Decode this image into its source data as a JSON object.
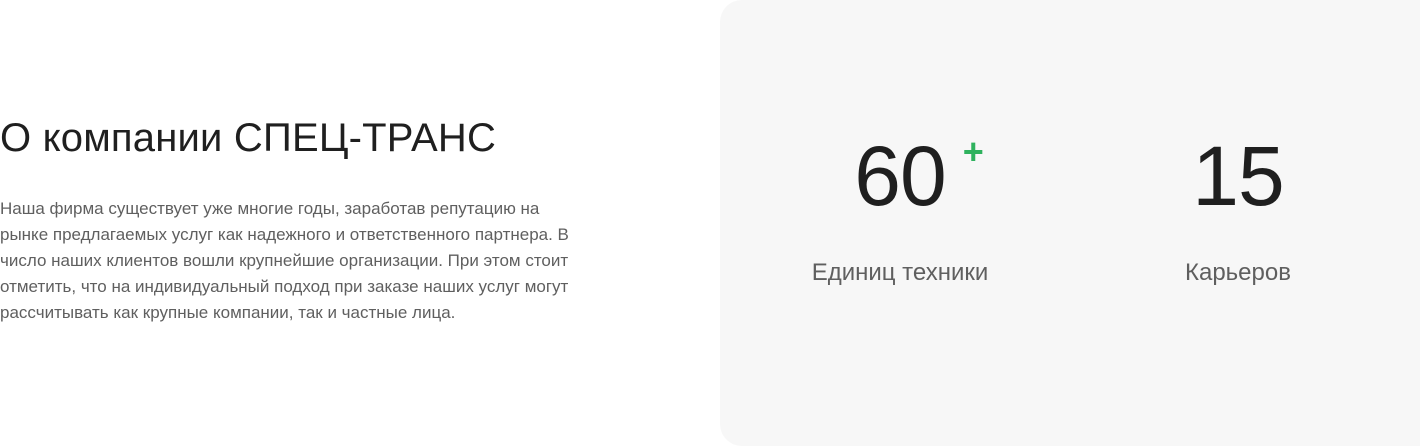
{
  "about": {
    "title": "О компании СПЕЦ-ТРАНС",
    "text": "Наша фирма существует уже многие годы, заработав репутацию на рынке предлагаемых услуг как надежного и ответственного партнера. В число наших клиентов вошли крупнейшие организации. При этом стоит отметить, что на индивидуальный подход при заказе наших услуг могут рассчитывать как крупные компании, так и частные лица."
  },
  "stats": [
    {
      "value": "60",
      "suffix": "+",
      "label": "Единиц техники"
    },
    {
      "value": "15",
      "suffix": "",
      "label": "Карьеров"
    }
  ],
  "colors": {
    "accent": "#2fb25e",
    "panel_background": "#f7f7f7",
    "heading": "#1f1f1f",
    "body_text": "#5f5f5f"
  }
}
